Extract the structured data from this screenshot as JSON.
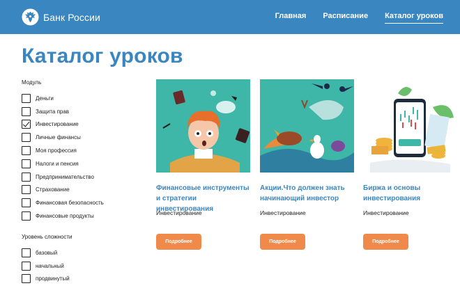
{
  "header": {
    "logo_text": "Банк России",
    "nav": [
      {
        "label": "Главная"
      },
      {
        "label": "Расписание"
      },
      {
        "label": "Каталог уроков",
        "active": true
      }
    ]
  },
  "page_title": "Каталог уроков",
  "filters": {
    "module": {
      "title": "Модуль",
      "options": [
        {
          "label": "Деньги",
          "checked": false
        },
        {
          "label": "Защита прав",
          "checked": false
        },
        {
          "label": "Инвестирование",
          "checked": true
        },
        {
          "label": "Личные финансы",
          "checked": false
        },
        {
          "label": "Моя профессия",
          "checked": false
        },
        {
          "label": "Налоги и пенсия",
          "checked": false
        },
        {
          "label": "Предпринимательство",
          "checked": false
        },
        {
          "label": "Страхование",
          "checked": false
        },
        {
          "label": "Финансовая безопасность",
          "checked": false
        },
        {
          "label": "Финансовые продукты",
          "checked": false
        }
      ]
    },
    "level": {
      "title": "Уровень сложности",
      "options": [
        {
          "label": "базовый",
          "checked": false
        },
        {
          "label": "начальный",
          "checked": false
        },
        {
          "label": "продвинутый",
          "checked": false
        }
      ]
    }
  },
  "cards": [
    {
      "title": "Финансовые инструменты и стратегии инвестирования",
      "tag": "Инвестирование",
      "button": "Подробнее",
      "image": "boy-illustration"
    },
    {
      "title": "Акции.Что должен знать начинающий инвестор",
      "tag": "Инвестирование",
      "button": "Подробнее",
      "image": "birds-illustration"
    },
    {
      "title": "Биржа и основы инвестирования",
      "tag": "Инвестирование",
      "button": "Подробнее",
      "image": "stock-phone-illustration"
    }
  ],
  "colors": {
    "brand": "#3a86c0",
    "accent": "#f08a4b",
    "card_bg": "#3eb7a9"
  }
}
